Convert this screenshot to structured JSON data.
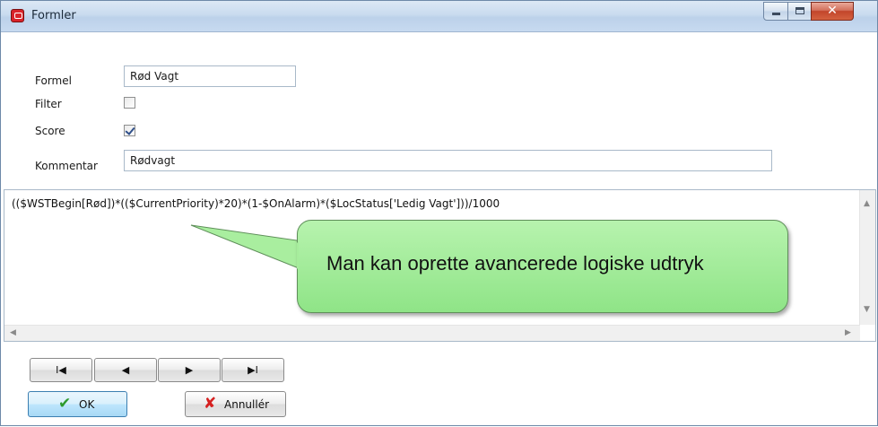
{
  "window": {
    "title": "Formler"
  },
  "form": {
    "formel_label": "Formel",
    "formel_value": "Rød Vagt",
    "filter_label": "Filter",
    "filter_checked": false,
    "score_label": "Score",
    "score_checked": true,
    "kommentar_label": "Kommentar",
    "kommentar_value": "Rødvagt"
  },
  "editor": {
    "expression": "(($WSTBegin[Rød])*(($CurrentPriority)*20)*(1-$OnAlarm)*($LocStatus['Ledig Vagt']))/1000"
  },
  "callout": {
    "text": "Man kan oprette avancerede logiske udtryk",
    "color": "#9ee894"
  },
  "navigation": {
    "first_glyph": "I◀",
    "prev_glyph": "◀",
    "next_glyph": "▶",
    "last_glyph": "▶I"
  },
  "actions": {
    "ok_label": "OK",
    "cancel_label": "Annullér"
  }
}
